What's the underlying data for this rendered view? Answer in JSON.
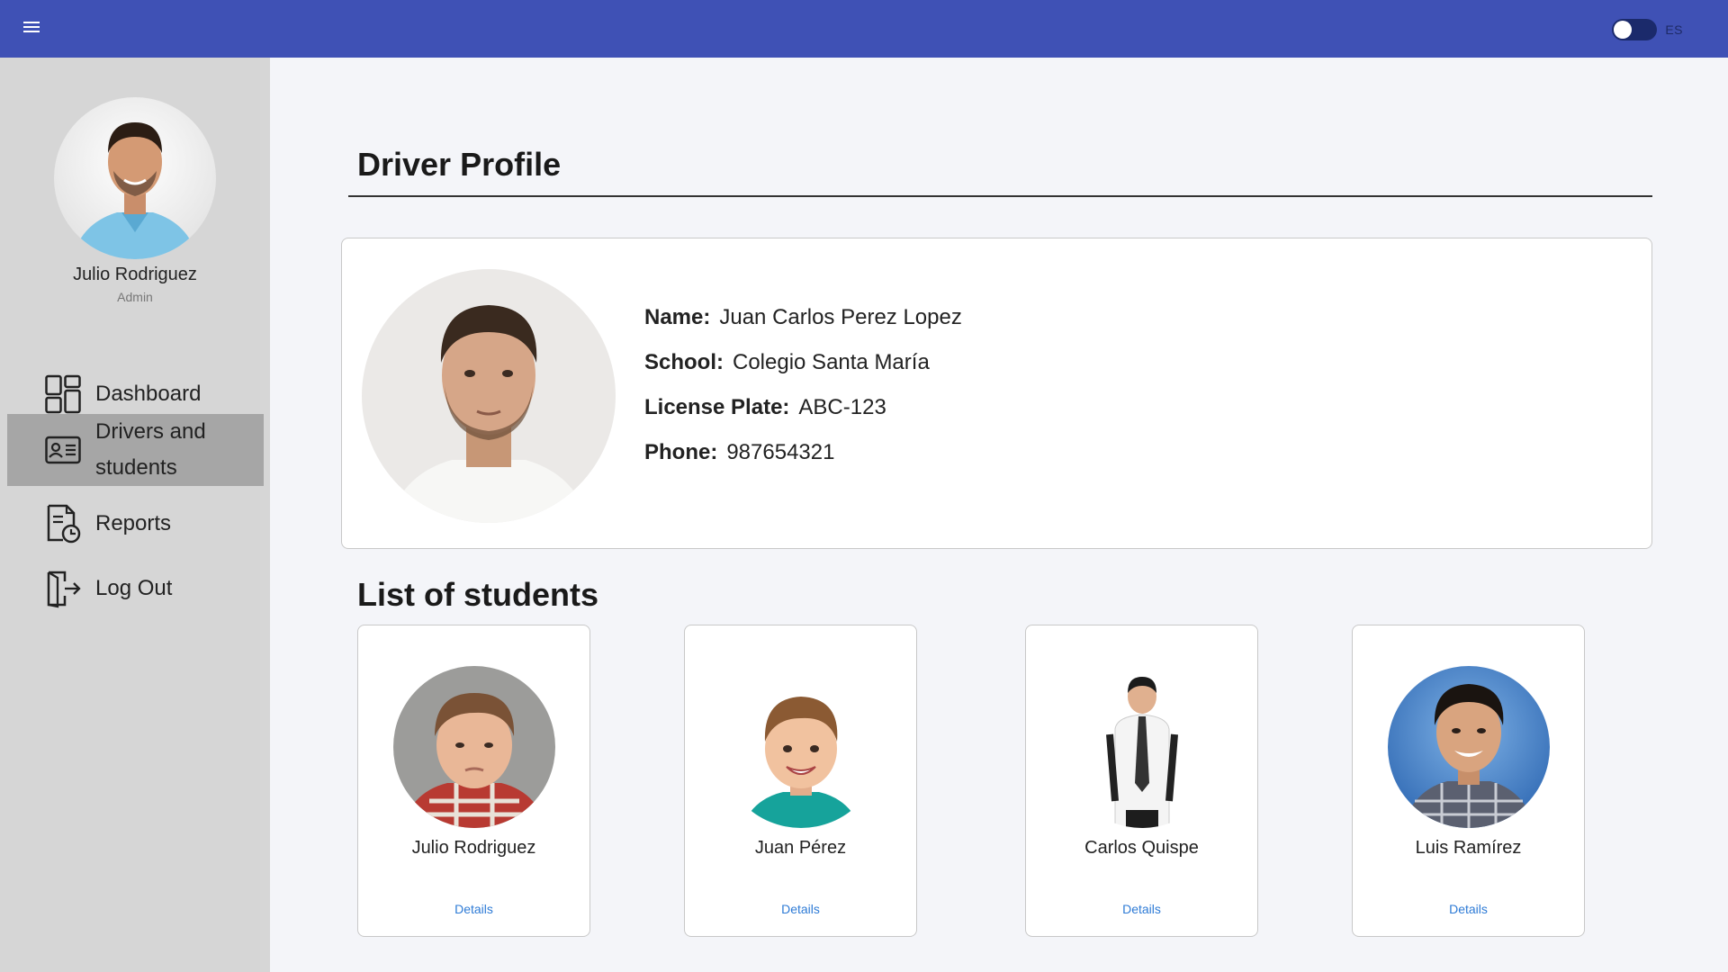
{
  "header": {
    "menu_icon": "hamburger-menu-icon",
    "language_toggle_label": "ES",
    "language_toggle_on": false,
    "brand_color": "#3f51b5"
  },
  "sidebar": {
    "user": {
      "name": "Julio Rodriguez",
      "role": "Admin"
    },
    "items": [
      {
        "label": "Dashboard",
        "icon": "dashboard-icon",
        "active": false
      },
      {
        "label": "Drivers and students",
        "icon": "id-card-icon",
        "active": true
      },
      {
        "label": "Reports",
        "icon": "report-document-icon",
        "active": false
      },
      {
        "label": "Log Out",
        "icon": "logout-icon",
        "active": false
      }
    ]
  },
  "main": {
    "title": "Driver Profile",
    "driver": {
      "fields": [
        {
          "label": "Name:",
          "value": "Juan Carlos Perez Lopez"
        },
        {
          "label": "School:",
          "value": "Colegio Santa María"
        },
        {
          "label": "License Plate:",
          "value": "ABC-123"
        },
        {
          "label": "Phone:",
          "value": "987654321"
        }
      ]
    },
    "students_title": "List of students",
    "students": [
      {
        "name": "Julio Rodriguez",
        "action": "Details"
      },
      {
        "name": "Juan Pérez",
        "action": "Details"
      },
      {
        "name": "Carlos Quispe",
        "action": "Details"
      },
      {
        "name": "Luis Ramírez",
        "action": "Details"
      }
    ],
    "link_color": "#2e7bd6"
  }
}
